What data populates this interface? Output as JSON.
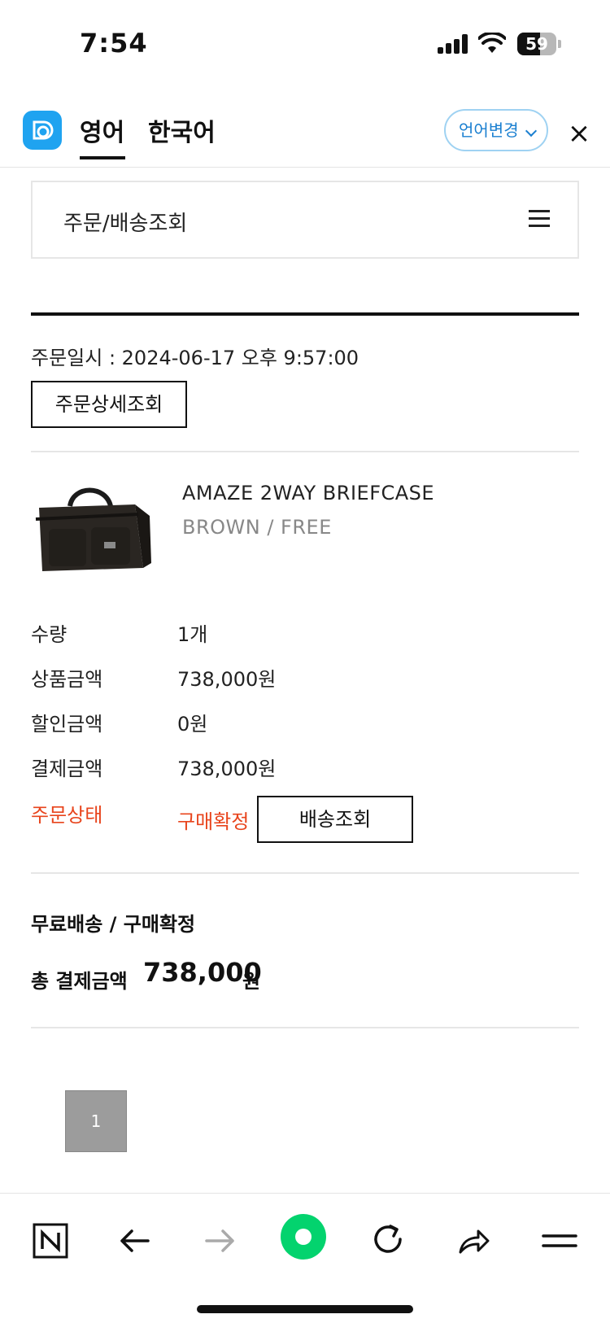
{
  "status_bar": {
    "time": "7:54",
    "battery_level": "59",
    "battery_fraction": 0.59
  },
  "translate_bar": {
    "tab_source": "영어",
    "tab_target": "한국어",
    "change_language": "언어변경",
    "close": "×"
  },
  "page": {
    "nav_title": "주문/배송조회",
    "order_date": "주문일시 : 2024-06-17 오후 9:57:00",
    "order_detail_button": "주문상세조회",
    "product": {
      "name": "AMAZE 2WAY BRIEFCASE",
      "option": "BROWN / FREE"
    },
    "rows": [
      {
        "label": "수량",
        "value": "1개"
      },
      {
        "label": "상품금액",
        "value": "738,000원"
      },
      {
        "label": "할인금액",
        "value": "0원"
      },
      {
        "label": "결제금액",
        "value": "738,000원"
      }
    ],
    "status": {
      "label": "주문상태",
      "value": "구매확정",
      "ship_button": "배송조회"
    },
    "summary": {
      "title": "무료배송 / 구매확정",
      "total_label": "총 결제금액",
      "total_amount": "738,000",
      "total_unit": "원"
    },
    "pagination": {
      "current": "1"
    }
  },
  "toolbar": {
    "items": [
      "naver-home-icon",
      "back-arrow-icon",
      "forward-arrow-icon",
      "green-dot-icon",
      "refresh-icon",
      "share-icon",
      "menu-icon"
    ]
  },
  "colors": {
    "accent_red": "#e8441c",
    "papago_blue": "#1fa3f0",
    "green_dot": "#03d36e"
  }
}
